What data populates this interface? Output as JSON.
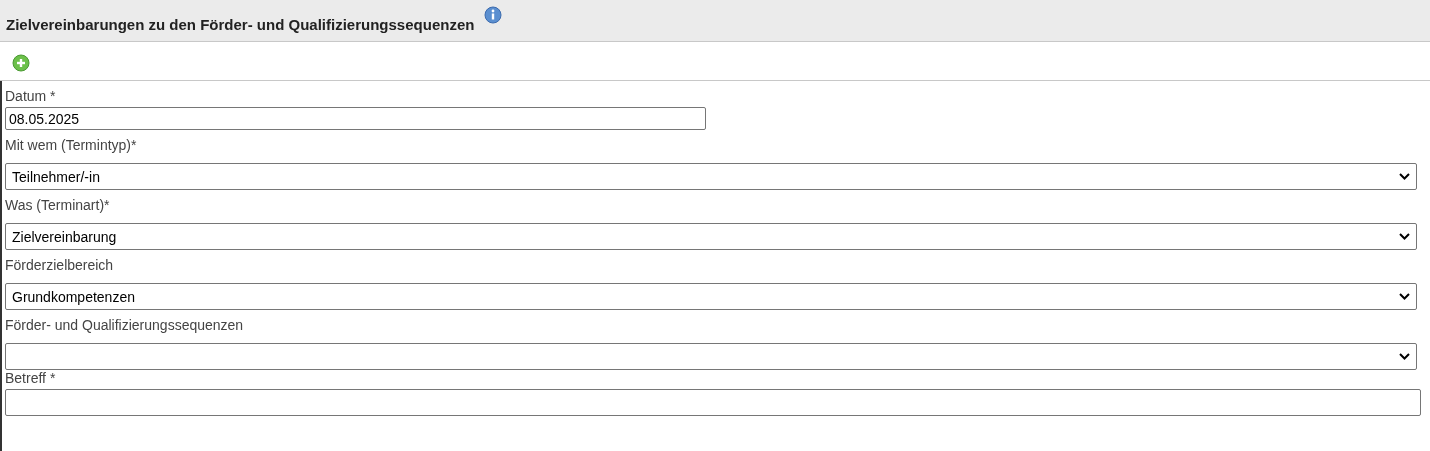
{
  "panel": {
    "title": "Zielvereinbarungen zu den Förder- und Qualifizierungssequenzen"
  },
  "fields": [
    {
      "kind": "date",
      "label": "Datum *",
      "value": "08.05.2025"
    },
    {
      "kind": "select",
      "label": "Mit wem (Termintyp)*",
      "value": "Teilnehmer/-in"
    },
    {
      "kind": "select",
      "label": "Was (Terminart)*",
      "value": "Zielvereinbarung"
    },
    {
      "kind": "select",
      "label": "Förderzielbereich",
      "value": "Grundkompetenzen"
    },
    {
      "kind": "select",
      "label": "Förder- und Qualifizierungssequenzen"
    },
    {
      "kind": "text",
      "label": "Betreff *"
    }
  ]
}
